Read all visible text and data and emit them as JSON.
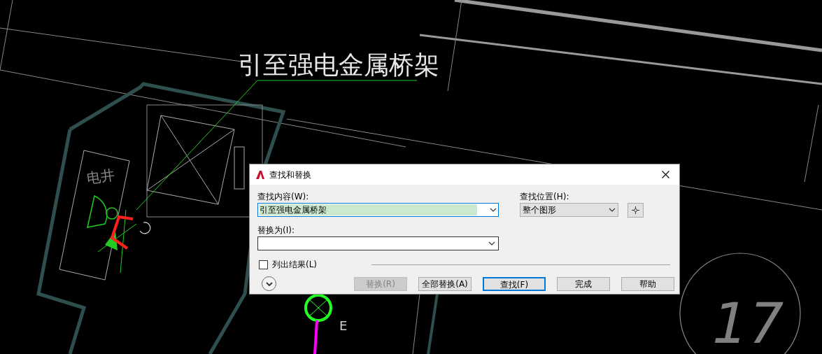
{
  "drawing": {
    "leader_label": "引至强电金属桥架",
    "room_label": "电井",
    "grid_marker": "17",
    "axis_letter": "E"
  },
  "dialog": {
    "title": "查找和替换",
    "find_what": {
      "label": "查找内容(W):",
      "value": "引至强电金属桥架"
    },
    "look_in": {
      "label": "查找位置(H):",
      "value": "整个图形"
    },
    "replace_with": {
      "label": "替换为(I):"
    },
    "list_results": {
      "label": "列出结果(L)",
      "checked": false
    },
    "buttons": [
      {
        "label": "替换(R)",
        "disabled": true,
        "default": false
      },
      {
        "label": "全部替换(A)",
        "disabled": false,
        "default": false
      },
      {
        "label": "查找(F)",
        "disabled": false,
        "default": true
      },
      {
        "label": "完成",
        "disabled": false,
        "default": false
      },
      {
        "label": "帮助",
        "disabled": false,
        "default": false
      }
    ]
  }
}
